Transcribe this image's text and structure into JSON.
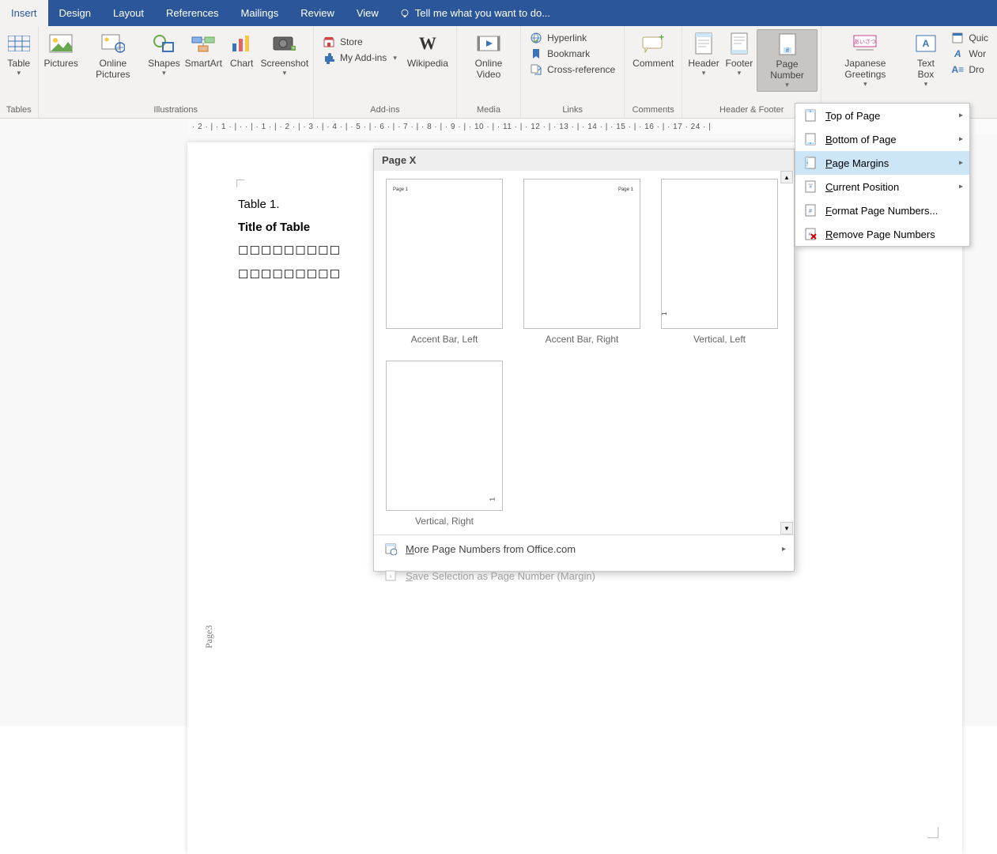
{
  "tabs": {
    "insert": "Insert",
    "design": "Design",
    "layout": "Layout",
    "references": "References",
    "mailings": "Mailings",
    "review": "Review",
    "view": "View",
    "tellme_placeholder": "Tell me what you want to do..."
  },
  "ribbon": {
    "tables_group": "Tables",
    "table_btn": "Table",
    "illustrations_group": "Illustrations",
    "pictures": "Pictures",
    "online_pictures": "Online Pictures",
    "shapes": "Shapes",
    "smartart": "SmartArt",
    "chart": "Chart",
    "screenshot": "Screenshot",
    "addins_group": "Add-ins",
    "store": "Store",
    "my_addins": "My Add-ins",
    "wikipedia": "Wikipedia",
    "media_group": "Media",
    "online_video": "Online Video",
    "links_group": "Links",
    "hyperlink": "Hyperlink",
    "bookmark": "Bookmark",
    "cross_reference": "Cross-reference",
    "comments_group": "Comments",
    "comment": "Comment",
    "headerfooter_group": "Header & Footer",
    "header": "Header",
    "footer": "Footer",
    "page_number": "Page Number",
    "text_group_jg": "Japanese Greetings",
    "text_group_tb": "Text Box",
    "quick": "Quic",
    "wordart": "Wor",
    "drop": "Dro"
  },
  "menu": {
    "top_of_page": "Top of Page",
    "bottom_of_page": "Bottom of Page",
    "page_margins": "Page Margins",
    "current_position": "Current Position",
    "format_numbers": "Format Page Numbers...",
    "remove_numbers": "Remove Page Numbers"
  },
  "gallery": {
    "heading": "Page X",
    "accent_bar_left": "Accent Bar, Left",
    "accent_bar_right": "Accent Bar, Right",
    "vertical_left": "Vertical, Left",
    "vertical_right": "Vertical, Right",
    "more_from_office": "More Page Numbers from Office.com",
    "save_selection": "Save Selection as Page Number (Margin)",
    "thumb_label": "Page 1",
    "thumb_num": "1"
  },
  "document": {
    "table_ref": "Table 1.",
    "table_title": "Title of Table",
    "row": "☐☐☐☐☐☐☐☐☐",
    "side_page": "Page3"
  },
  "ruler_text": "· 2 · | · 1 · | ·  · | · 1 · | · 2 · | · 3 · | · 4 · | · 5 · | · 6 · | · 7 · | · 8 · | · 9 · | · 10 · | · 11 · | · 12 · | · 13 · | · 14 · | · 15 · | · 16 · | · 17 ·                                           24 · |"
}
